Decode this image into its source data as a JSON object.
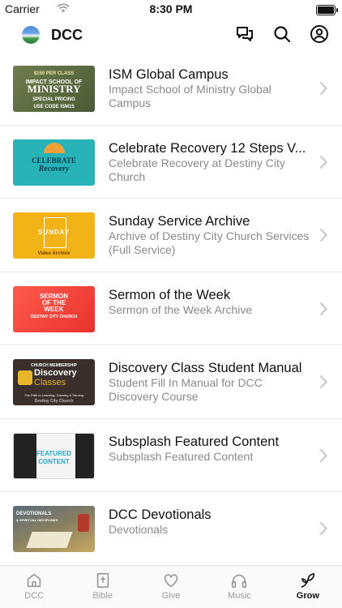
{
  "status_bar": {
    "carrier": "Carrier",
    "time": "8:30 PM"
  },
  "header": {
    "title": "DCC",
    "icons": [
      "chat-icon",
      "search-icon",
      "profile-icon"
    ]
  },
  "items": [
    {
      "title": "ISM Global Campus",
      "subtitle": "Impact School of Ministry Global Campus",
      "thumb_lines": [
        "$150 PER CLASS",
        "IMPACT SCHOOL OF",
        "MINISTRY",
        "SPECIAL PRICING",
        "USE CODE ISM15"
      ]
    },
    {
      "title": "Celebrate Recovery 12 Steps V...",
      "subtitle": "Celebrate Recovery at Destiny City Church",
      "thumb_lines": [
        "CELEBRATE",
        "Recovery"
      ]
    },
    {
      "title": "Sunday Service Archive",
      "subtitle": "Archive of Destiny City Church Services (Full Service)",
      "thumb_lines": [
        "SUNDAY",
        "Video Archive"
      ]
    },
    {
      "title": "Sermon of the Week",
      "subtitle": "Sermon of the Week Archive",
      "thumb_lines": [
        "SERMON",
        "OF THE",
        "WEEK",
        "DESTINY CITY CHURCH"
      ]
    },
    {
      "title": "Discovery Class Student Manual",
      "subtitle": "Student Fill In Manual for DCC Discovery Course",
      "thumb_lines": [
        "CHURCH MEMBERSHIP",
        "Discovery",
        "Classes",
        "The Path to Learning, Growing & Serving",
        "Destiny City Church"
      ]
    },
    {
      "title": "Subsplash Featured Content",
      "subtitle": "Subsplash Featured Content",
      "thumb_lines": [
        "FEATURED",
        "CONTENT"
      ]
    },
    {
      "title": "DCC Devotionals",
      "subtitle": "Devotionals",
      "thumb_lines": [
        "DEVOTIONALS",
        "& SPIRITUAL DISCIPLINES"
      ]
    }
  ],
  "tabs": [
    {
      "label": "DCC",
      "icon": "home-icon",
      "active": false
    },
    {
      "label": "Bible",
      "icon": "bible-icon",
      "active": false
    },
    {
      "label": "Give",
      "icon": "heart-icon",
      "active": false
    },
    {
      "label": "Music",
      "icon": "headphones-icon",
      "active": false
    },
    {
      "label": "Grow",
      "icon": "leaf-icon",
      "active": true
    }
  ],
  "colors": {
    "accent": "#111111",
    "inactive_tab": "#9a9a9a",
    "subtitle": "#8a8a8a"
  }
}
